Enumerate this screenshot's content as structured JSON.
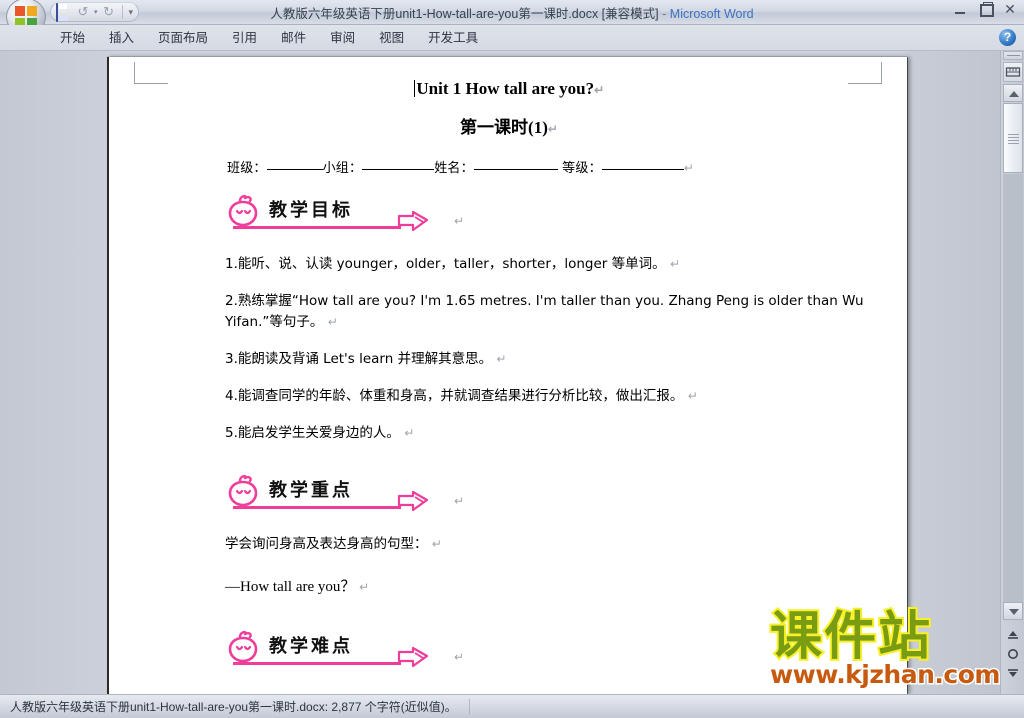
{
  "window": {
    "title_document": "人教版六年级英语下册unit1-How-tall-are-you第一课时.docx [兼容模式]",
    "title_sep": "-",
    "title_app": "Microsoft Word",
    "minimize": "–",
    "restore": "❐",
    "close": "✕"
  },
  "quick_access": {
    "save": "save-icon",
    "undo": "↺",
    "undo_caret": "▾",
    "redo": "↻",
    "customize": "▾"
  },
  "ribbon": {
    "tabs": [
      {
        "label": "开始"
      },
      {
        "label": "插入"
      },
      {
        "label": "页面布局"
      },
      {
        "label": "引用"
      },
      {
        "label": "邮件"
      },
      {
        "label": "审阅"
      },
      {
        "label": "视图"
      },
      {
        "label": "开发工具"
      }
    ],
    "help": "?"
  },
  "document": {
    "title": "Unit 1 How tall are you?",
    "title_pilcrow": "↵",
    "subtitle": "第一课时",
    "subtitle_num": "(1)",
    "subtitle_pilcrow": "↵",
    "fields": {
      "class_label": "班级：",
      "group_label": "小组：",
      "name_label": "姓名：",
      "grade_label": "等级：",
      "pilcrow": "↵"
    },
    "sections": [
      {
        "heading": "教学目标",
        "pilcrow": "↵",
        "paragraphs": [
          {
            "text": "1.能听、说、认读 younger，older，taller，shorter，longer 等单词。",
            "pilcrow": "↵"
          },
          {
            "text": "2.熟练掌握“How tall are you? I'm 1.65 metres. I'm taller than you. Zhang Peng is older than Wu Yifan.”等句子。",
            "pilcrow": "↵"
          },
          {
            "text": "3.能朗读及背诵 Let's learn 并理解其意思。",
            "pilcrow": "↵"
          },
          {
            "text": "4.能调查同学的年龄、体重和身高，并就调查结果进行分析比较，做出汇报。",
            "pilcrow": "↵"
          },
          {
            "text": "5.能启发学生关爱身边的人。",
            "pilcrow": "↵"
          }
        ]
      },
      {
        "heading": "教学重点",
        "pilcrow": "↵",
        "paragraphs": [
          {
            "text": "学会询问身高及表达身高的句型：",
            "pilcrow": "↵"
          },
          {
            "text": "—How tall are you？",
            "pilcrow": "↵"
          }
        ]
      },
      {
        "heading": "教学难点",
        "pilcrow": "↵",
        "paragraphs": []
      }
    ]
  },
  "watermark": {
    "text_cn": "课件站",
    "text_url": "www.kjzhan.com",
    "color_cn": "#7a9c12",
    "color_cn_stroke": "#f7f02a",
    "color_url": "#c75a0e"
  },
  "statusbar": {
    "text": "人教版六年级英语下册unit1-How-tall-are-you第一课时.docx: 2,877 个字符(近似值)。"
  },
  "scrollbar": {
    "split": "split-window-handle",
    "view_ruler": "view-ruler-icon",
    "up": "▲",
    "down": "▼",
    "prev_page": "⎓",
    "select_object": "◯",
    "next_page": "⎓"
  }
}
